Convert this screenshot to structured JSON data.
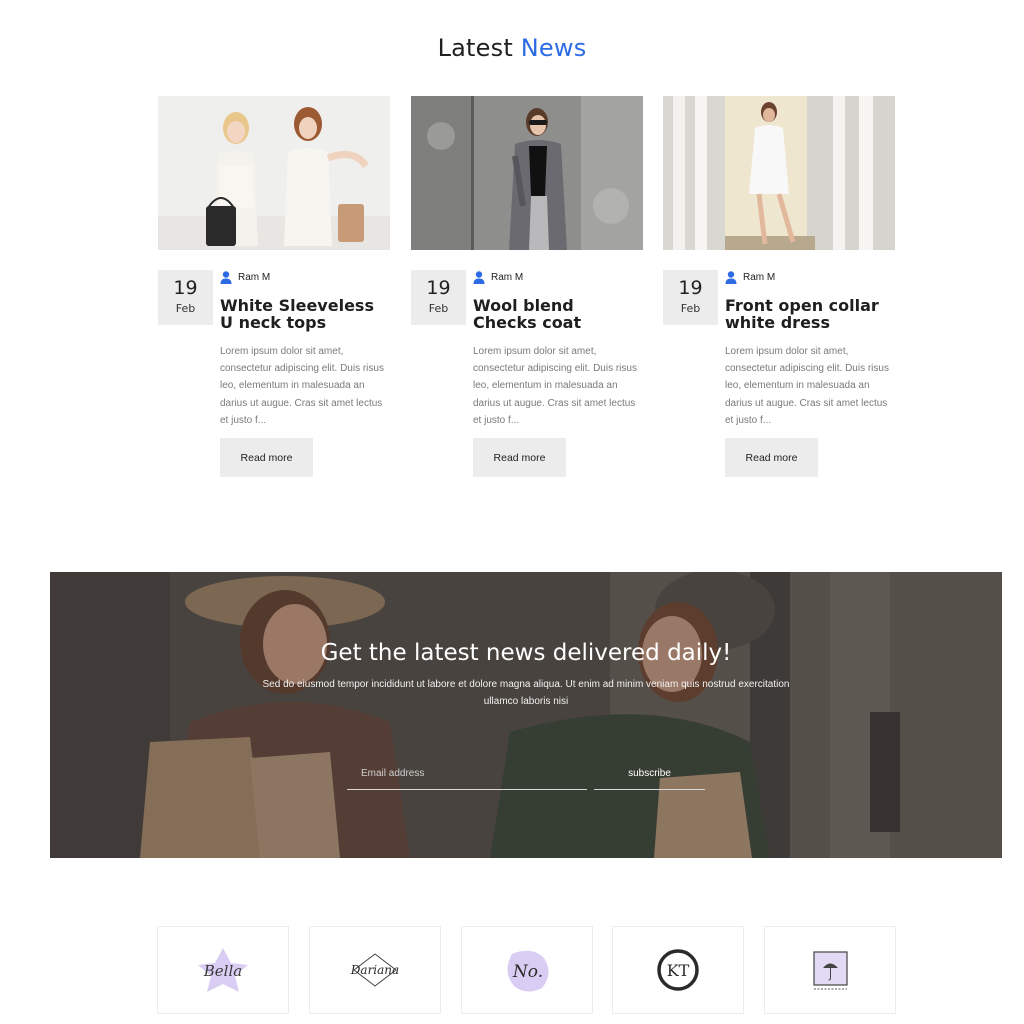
{
  "section": {
    "title_main": "Latest",
    "title_accent": "News"
  },
  "posts": [
    {
      "day": "19",
      "month": "Feb",
      "author": "Ram M",
      "title": "White Sleeveless U neck tops",
      "excerpt": "Lorem ipsum dolor sit amet, consectetur adipiscing elit. Duis risus leo, elementum in malesuada an darius ut augue. Cras sit amet lectus et justo f...",
      "cta": "Read more"
    },
    {
      "day": "19",
      "month": "Feb",
      "author": "Ram M",
      "title": "Wool blend Checks coat",
      "excerpt": "Lorem ipsum dolor sit amet, consectetur adipiscing elit. Duis risus leo, elementum in malesuada an darius ut augue. Cras sit amet lectus et justo f...",
      "cta": "Read more"
    },
    {
      "day": "19",
      "month": "Feb",
      "author": "Ram M",
      "title": "Front open collar white dress",
      "excerpt": "Lorem ipsum dolor sit amet, consectetur adipiscing elit. Duis risus leo, elementum in malesuada an darius ut augue. Cras sit amet lectus et justo f...",
      "cta": "Read more"
    }
  ],
  "newsletter": {
    "title": "Get the latest news delivered daily!",
    "description": "Sed do eiusmod tempor incididunt ut labore et dolore magna aliqua. Ut enim ad minim veniam quis nostrud exercitation ullamco laboris nisi",
    "email_placeholder": "Email address",
    "subscribe_label": "subscribe"
  },
  "brands": [
    {
      "name": "Bella",
      "icon": "bella-logo"
    },
    {
      "name": "Dariana",
      "icon": "dariana-logo"
    },
    {
      "name": "No.",
      "icon": "no-logo"
    },
    {
      "name": "KT",
      "icon": "kt-logo"
    },
    {
      "name": "",
      "icon": "umbrella-frame-logo"
    }
  ],
  "colors": {
    "accent": "#2d6be4",
    "date_box": "#ececec",
    "button": "#ececec",
    "logo_purple": "#d9cdf3"
  }
}
